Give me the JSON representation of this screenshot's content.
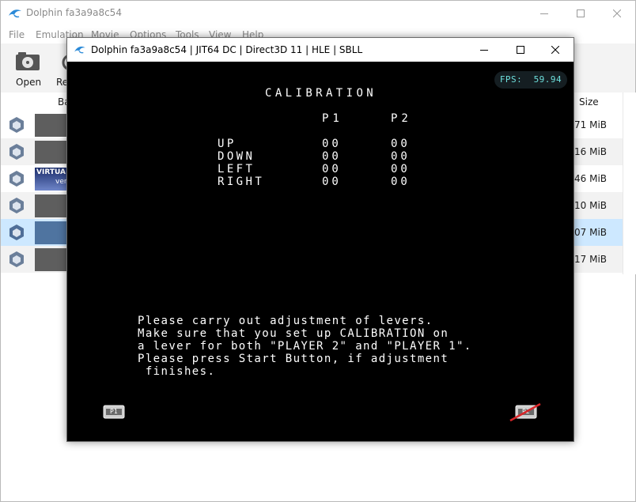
{
  "main_window": {
    "title": "Dolphin fa3a9a8c54",
    "menu": [
      "File",
      "Emulation",
      "Movie",
      "Options",
      "Tools",
      "View",
      "Help"
    ],
    "toolbar": {
      "open_label": "Open",
      "refresh_label": "Re"
    },
    "columns": {
      "banner": "Ba",
      "size": "Size"
    },
    "rows": [
      {
        "size": "71 MiB"
      },
      {
        "size": "16 MiB"
      },
      {
        "size": "46 MiB",
        "banner_text": "VIRTUA",
        "banner_sub": "ver"
      },
      {
        "size": "10 MiB"
      },
      {
        "size": "07 MiB"
      },
      {
        "size": "17 MiB"
      }
    ]
  },
  "render_window": {
    "title": "Dolphin fa3a9a8c54 | JIT64 DC | Direct3D 11 | HLE | SBLL",
    "fps_label": "FPS:",
    "fps_value": "59.94",
    "screen": {
      "title": "CALIBRATION",
      "col_p1": "P1",
      "col_p2": "P2",
      "rows": [
        {
          "label": "UP",
          "p1": "00",
          "p2": "00"
        },
        {
          "label": "DOWN",
          "p1": "00",
          "p2": "00"
        },
        {
          "label": "LEFT",
          "p1": "00",
          "p2": "00"
        },
        {
          "label": "RIGHT",
          "p1": "00",
          "p2": "00"
        }
      ],
      "instructions": [
        "Please carry out adjustment of levers.",
        "Make sure that you set up CALIBRATION on",
        "a lever for both \"PLAYER 2\" and \"PLAYER 1\".",
        "Please press Start Button, if adjustment",
        " finishes."
      ],
      "coin_left": "P1",
      "coin_right": "P2"
    }
  },
  "colors": {
    "game_bg": "#000000",
    "fps_text": "#6ee0dd",
    "disabled_menu": "#8a8a8a",
    "selected_row": "#cde8ff",
    "strike": "#d8262a"
  }
}
